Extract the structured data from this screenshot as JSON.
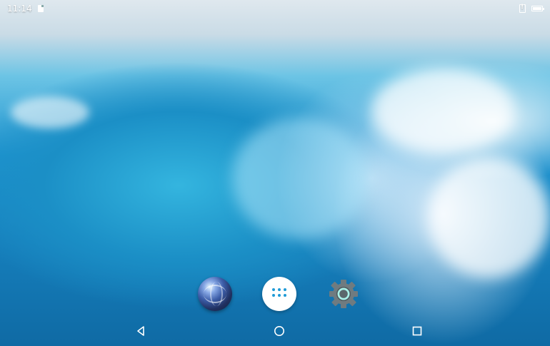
{
  "status_bar": {
    "time": "11:14",
    "battery_level": 1.0,
    "icons": [
      "sd-card-icon",
      "sim-card-icon",
      "battery-icon"
    ]
  },
  "wallpaper": {
    "subject": "ocean-wave-wallpaper",
    "colors": {
      "sky": "#dfe8ee",
      "wave": "#1d93cf",
      "foam": "#ffffff",
      "deep": "#0f6aa4"
    }
  },
  "dock": {
    "apps": [
      {
        "icon": "browser-globe-icon"
      },
      {
        "icon": "all-apps-icon"
      },
      {
        "icon": "settings-gear-icon"
      }
    ]
  },
  "nav_bar": {
    "buttons": [
      {
        "icon": "back-triangle-icon"
      },
      {
        "icon": "home-circle-icon"
      },
      {
        "icon": "recents-square-icon"
      }
    ]
  }
}
